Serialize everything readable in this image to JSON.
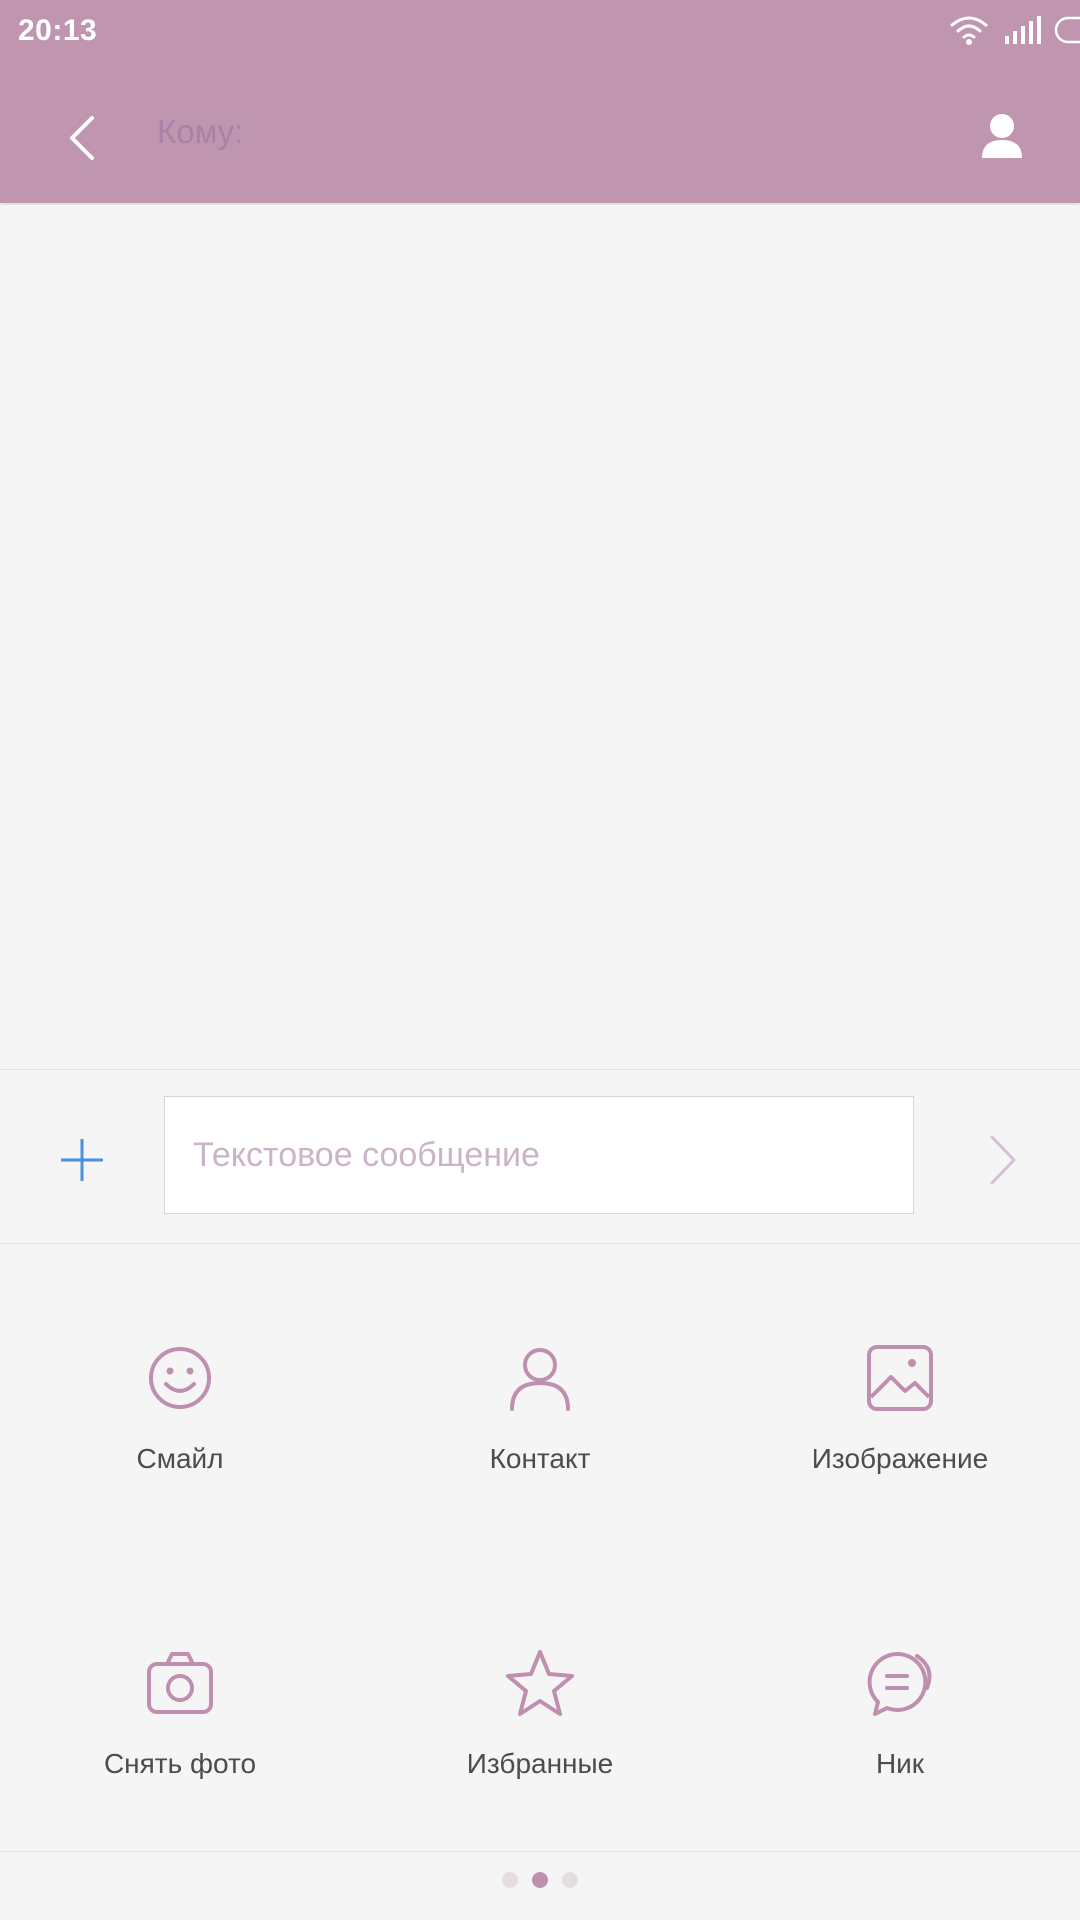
{
  "status_bar": {
    "time": "20:13",
    "icons": [
      "wifi-icon",
      "signal-icon",
      "battery-icon"
    ]
  },
  "header": {
    "back_icon": "chevron-left-icon",
    "to_label": "Кому:",
    "contact_icon": "person-icon"
  },
  "compose": {
    "add_icon": "plus-icon",
    "placeholder": "Текстовое сообщение",
    "value": "",
    "send_icon": "chevron-right-icon"
  },
  "attachments": [
    {
      "label": "Смайл",
      "icon": "smiley-icon"
    },
    {
      "label": "Контакт",
      "icon": "person-outline-icon"
    },
    {
      "label": "Изображение",
      "icon": "image-icon"
    },
    {
      "label": "Снять фото",
      "icon": "camera-icon"
    },
    {
      "label": "Избранные",
      "icon": "star-icon"
    },
    {
      "label": "Ник",
      "icon": "chat-bubbles-icon"
    }
  ],
  "pager": {
    "count": 3,
    "active": 1
  },
  "colors": {
    "header": "#bf95b0",
    "accent_icon": "#bf8fb0",
    "plus_blue": "#4a90e2",
    "background": "#f6f5f6"
  }
}
